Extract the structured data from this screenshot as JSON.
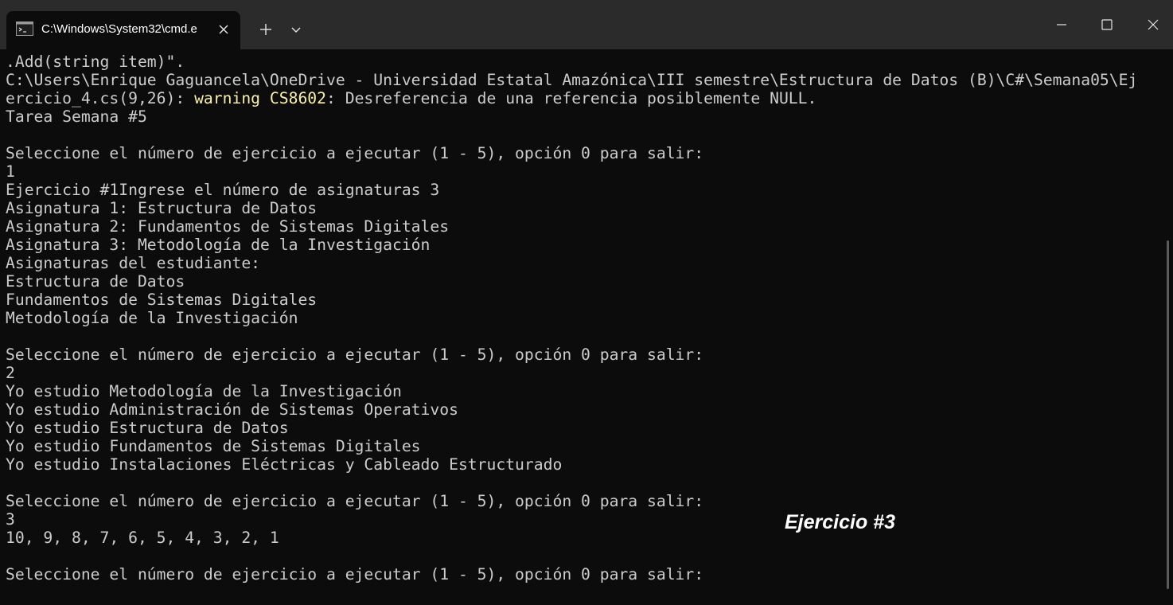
{
  "window": {
    "tab_title": "C:\\Windows\\System32\\cmd.e",
    "icons": {
      "tab": "terminal-icon",
      "tab_close": "close-icon",
      "new_tab": "plus-icon",
      "dropdown": "chevron-down-icon",
      "minimize": "minimize-icon",
      "maximize": "maximize-icon",
      "close": "close-icon"
    }
  },
  "colors": {
    "background": "#0c0c0c",
    "titlebar": "#2b2b2b",
    "text": "#cccccc",
    "warning": "#f9f1a5"
  },
  "console": {
    "line_1": ".Add(string item)\".",
    "line_2": "C:\\Users\\Enrique Gaguancela\\OneDrive - Universidad Estatal Amazónica\\III semestre\\Estructura de Datos (B)\\C#\\Semana05\\Ej",
    "line_3a": "ercicio_4.cs(9,26): ",
    "line_3b": "warning CS8602",
    "line_3c": ": Desreferencia de una referencia posiblemente NULL.",
    "line_4": "Tarea Semana #5",
    "line_6": "Seleccione el número de ejercicio a ejecutar (1 - 5), opción 0 para salir:",
    "line_7": "1",
    "line_8": "Ejercicio #1Ingrese el número de asignaturas 3",
    "line_9": "Asignatura 1: Estructura de Datos",
    "line_10": "Asignatura 2: Fundamentos de Sistemas Digitales",
    "line_11": "Asignatura 3: Metodología de la Investigación",
    "line_12": "Asignaturas del estudiante:",
    "line_13": "Estructura de Datos",
    "line_14": "Fundamentos de Sistemas Digitales",
    "line_15": "Metodología de la Investigación",
    "line_17": "Seleccione el número de ejercicio a ejecutar (1 - 5), opción 0 para salir:",
    "line_18": "2",
    "line_19": "Yo estudio Metodología de la Investigación",
    "line_20": "Yo estudio Administración de Sistemas Operativos",
    "line_21": "Yo estudio Estructura de Datos",
    "line_22": "Yo estudio Fundamentos de Sistemas Digitales",
    "line_23": "Yo estudio Instalaciones Eléctricas y Cableado Estructurado",
    "line_25": "Seleccione el número de ejercicio a ejecutar (1 - 5), opción 0 para salir:",
    "line_26": "3",
    "line_27": "10, 9, 8, 7, 6, 5, 4, 3, 2, 1",
    "line_29": "Seleccione el número de ejercicio a ejecutar (1 - 5), opción 0 para salir:"
  },
  "annotation": "Ejercicio #3"
}
